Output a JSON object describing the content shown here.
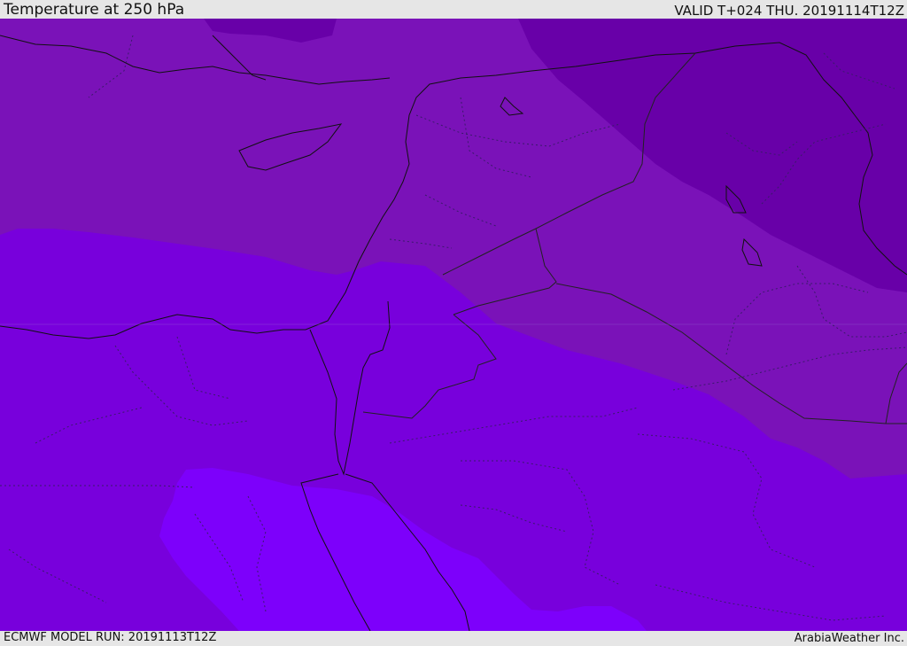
{
  "header": {
    "title": "Temperature at 250 hPa",
    "valid": "VALID T+024 THU. 20191114T12Z"
  },
  "footer": {
    "model_run": "ECMWF MODEL RUN: 20191113T12Z",
    "credit": "ArabiaWeather Inc."
  },
  "colors": {
    "band_coldest": "#6800a8",
    "band_cold": "#7a12b8",
    "band_mid": "#7800dc",
    "band_warm": "#7d00fb",
    "coastline": "#111111",
    "borders": "#222222",
    "background": "#e6e6e6"
  }
}
